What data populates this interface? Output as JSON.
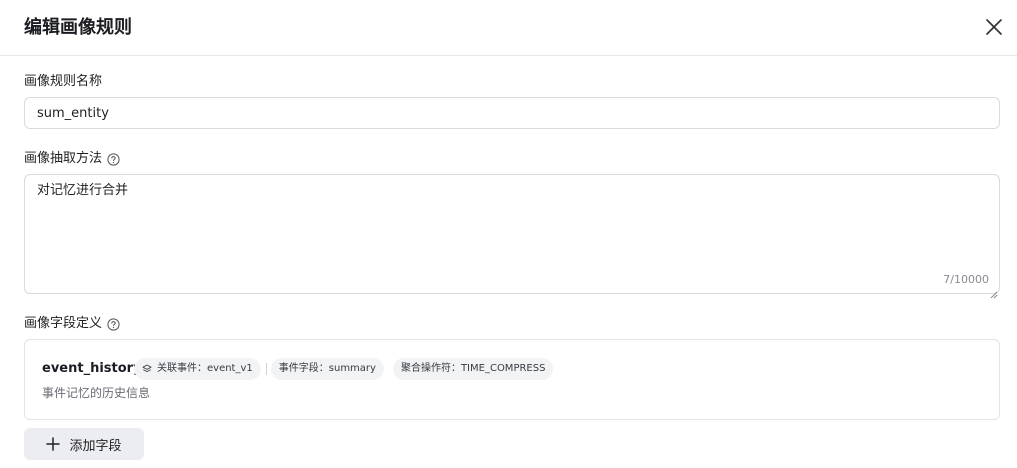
{
  "dialog": {
    "title": "编辑画像规则",
    "close_icon": "close-icon"
  },
  "name_field": {
    "label": "画像规则名称",
    "value": "sum_entity"
  },
  "method_field": {
    "label": "画像抽取方法",
    "help_icon": "question-circle-icon",
    "value": "对记忆进行合并",
    "count": "7/10000"
  },
  "fields_section": {
    "label": "画像字段定义",
    "help_icon": "question-circle-icon",
    "items": [
      {
        "name": "event_history",
        "tags": [
          {
            "icon": "layers-icon",
            "text": "关联事件：event_v1"
          },
          {
            "text": "事件字段：summary"
          },
          {
            "text": "聚合操作符：TIME_COMPRESS"
          }
        ],
        "description": "事件记忆的历史信息"
      }
    ]
  },
  "add_button": {
    "label": "添加字段",
    "icon": "plus-icon"
  }
}
